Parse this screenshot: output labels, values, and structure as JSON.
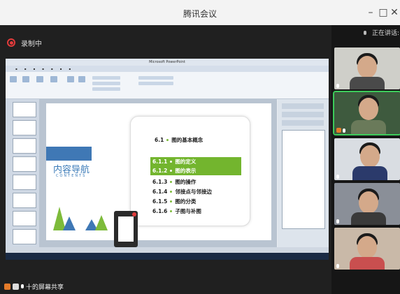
{
  "window": {
    "title": "腾讯会议",
    "minimize": "–",
    "maximize": "□",
    "close": "✕"
  },
  "recording": {
    "label": "录制中"
  },
  "speaking": {
    "label": "正在讲话:"
  },
  "shared_screen": {
    "app_title": "Microsoft PowerPoint",
    "slide": {
      "heading": "内容导航",
      "subheading": "CONTENTS",
      "toc": [
        {
          "num": "6.1",
          "text": "图的基本概念",
          "highlight": false
        },
        {
          "num": "6.1.1",
          "text": "图的定义",
          "highlight": true
        },
        {
          "num": "6.1.2",
          "text": "图的表示",
          "highlight": true
        },
        {
          "num": "6.1.3",
          "text": "图的操作",
          "highlight": false
        },
        {
          "num": "6.1.4",
          "text": "邻接点与邻接边",
          "highlight": false
        },
        {
          "num": "6.1.5",
          "text": "图的分类",
          "highlight": false
        },
        {
          "num": "6.1.6",
          "text": "子图与补图",
          "highlight": false
        }
      ]
    }
  },
  "bottom": {
    "share_label": "十的屏幕共享"
  },
  "colors": {
    "accent_green": "#73b52e",
    "slide_blue": "#3f78b5",
    "recording_red": "#e23b3b",
    "active_speaker": "#3ccb5a"
  },
  "icons": [
    "microphone-icon",
    "recording-icon",
    "screen-share-icon",
    "camera-icon"
  ]
}
